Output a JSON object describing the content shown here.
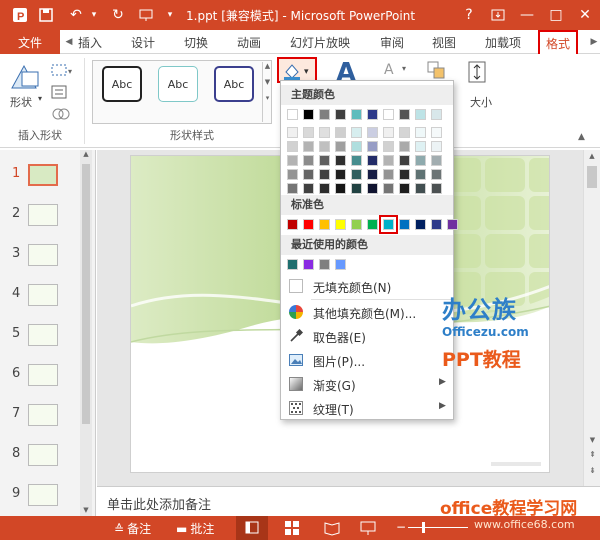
{
  "titlebar": {
    "title": "1.ppt [兼容模式] - Microsoft PowerPoint",
    "help": "?",
    "minimize": "—",
    "restore": "□",
    "close": "✕"
  },
  "tabs": {
    "file": "文件",
    "items": [
      "插入",
      "设计",
      "切换",
      "动画",
      "幻灯片放映",
      "审阅",
      "视图",
      "加载项"
    ],
    "active": "格式"
  },
  "ribbon": {
    "insert_shapes_group": "插入形状",
    "shape_label": "形状",
    "shape_styles_group": "形状样式",
    "style_samples": [
      "Abc",
      "Abc",
      "Abc"
    ],
    "size_label": "大小"
  },
  "thumbnails": [
    "1",
    "2",
    "3",
    "4",
    "5",
    "6",
    "7",
    "8",
    "9"
  ],
  "notes_placeholder": "单击此处添加备注",
  "statusbar": {
    "notes": "备注",
    "comments": "批注"
  },
  "fill_menu": {
    "theme_colors_header": "主题颜色",
    "standard_colors_header": "标准色",
    "recent_colors_header": "最近使用的颜色",
    "no_fill": "无填充颜色(N)",
    "more_colors": "其他填充颜色(M)...",
    "eyedropper": "取色器(E)",
    "picture": "图片(P)...",
    "gradient": "渐变(G)",
    "texture": "纹理(T)",
    "theme_top_row": [
      "#ffffff",
      "#000000",
      "#808080",
      "#3f3f3f",
      "#5fbcbd",
      "#2e3a8a",
      "#ffffff",
      "#555555",
      "#bde3e6",
      "#d8e7ea"
    ],
    "standard_colors": [
      "#c00000",
      "#ff0000",
      "#ffc000",
      "#ffff00",
      "#92d050",
      "#00b050",
      "#00b0c8",
      "#0070c0",
      "#002060",
      "#2e3a8a",
      "#7030a0"
    ],
    "recent_colors": [
      "#1f6f6f",
      "#8a2be2",
      "#7f7f7f",
      "#6699ff"
    ],
    "selected_standard_index": 6
  },
  "watermark": {
    "brand": "办公族",
    "url": "Officezu.com",
    "subtitle": "PPT教程",
    "site_name": "office教程学习网",
    "site_url": "www.office68.com"
  },
  "colors": {
    "accent": "#d24726",
    "highlight": "#e00000"
  }
}
